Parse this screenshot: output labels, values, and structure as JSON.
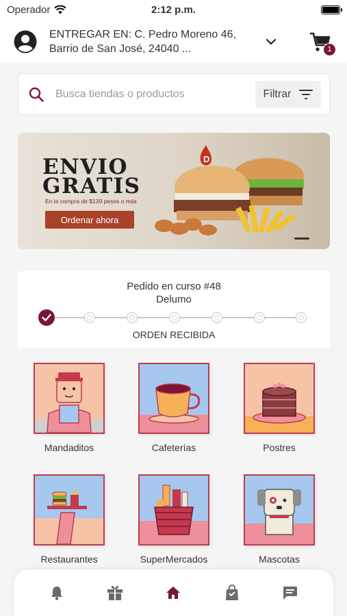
{
  "status_bar": {
    "carrier": "Operador",
    "time": "2:12 p.m."
  },
  "header": {
    "address_line1": "ENTREGAR EN: C. Pedro Moreno 46,",
    "address_line2": "Barrio de San José, 24040 ...",
    "cart_count": "1"
  },
  "search": {
    "placeholder": "Busca tiendas o productos",
    "filter_label": "Filtrar"
  },
  "banner": {
    "title_line1": "ENVIO",
    "title_line2": "GRATIS",
    "subtitle": "En la compra de $139 pesos o más",
    "button_label": "Ordenar ahora",
    "logo_letter": "D"
  },
  "order": {
    "title": "Pedido en curso #48",
    "store": "Delumo",
    "status": "ORDEN RECIBIDA",
    "steps_completed": 1,
    "steps_total": 7
  },
  "categories": [
    {
      "label": "Mandaditos",
      "icon": "delivery-person-icon"
    },
    {
      "label": "Cafeterías",
      "icon": "coffee-cup-icon"
    },
    {
      "label": "Postres",
      "icon": "cake-icon"
    },
    {
      "label": "Restaurantes",
      "icon": "food-tray-icon"
    },
    {
      "label": "SuperMercados",
      "icon": "grocery-basket-icon"
    },
    {
      "label": "Mascotas",
      "icon": "dog-icon"
    }
  ],
  "bottom_nav": [
    {
      "name": "notifications",
      "icon": "bell-icon",
      "active": false
    },
    {
      "name": "promotions",
      "icon": "gift-icon",
      "active": false
    },
    {
      "name": "home",
      "icon": "home-icon",
      "active": true
    },
    {
      "name": "orders",
      "icon": "shopping-bag-icon",
      "active": false
    },
    {
      "name": "messages",
      "icon": "chat-icon",
      "active": false
    }
  ],
  "colors": {
    "accent": "#7a1535",
    "tile_border": "#c23a4c",
    "banner_button": "#a8432a"
  }
}
